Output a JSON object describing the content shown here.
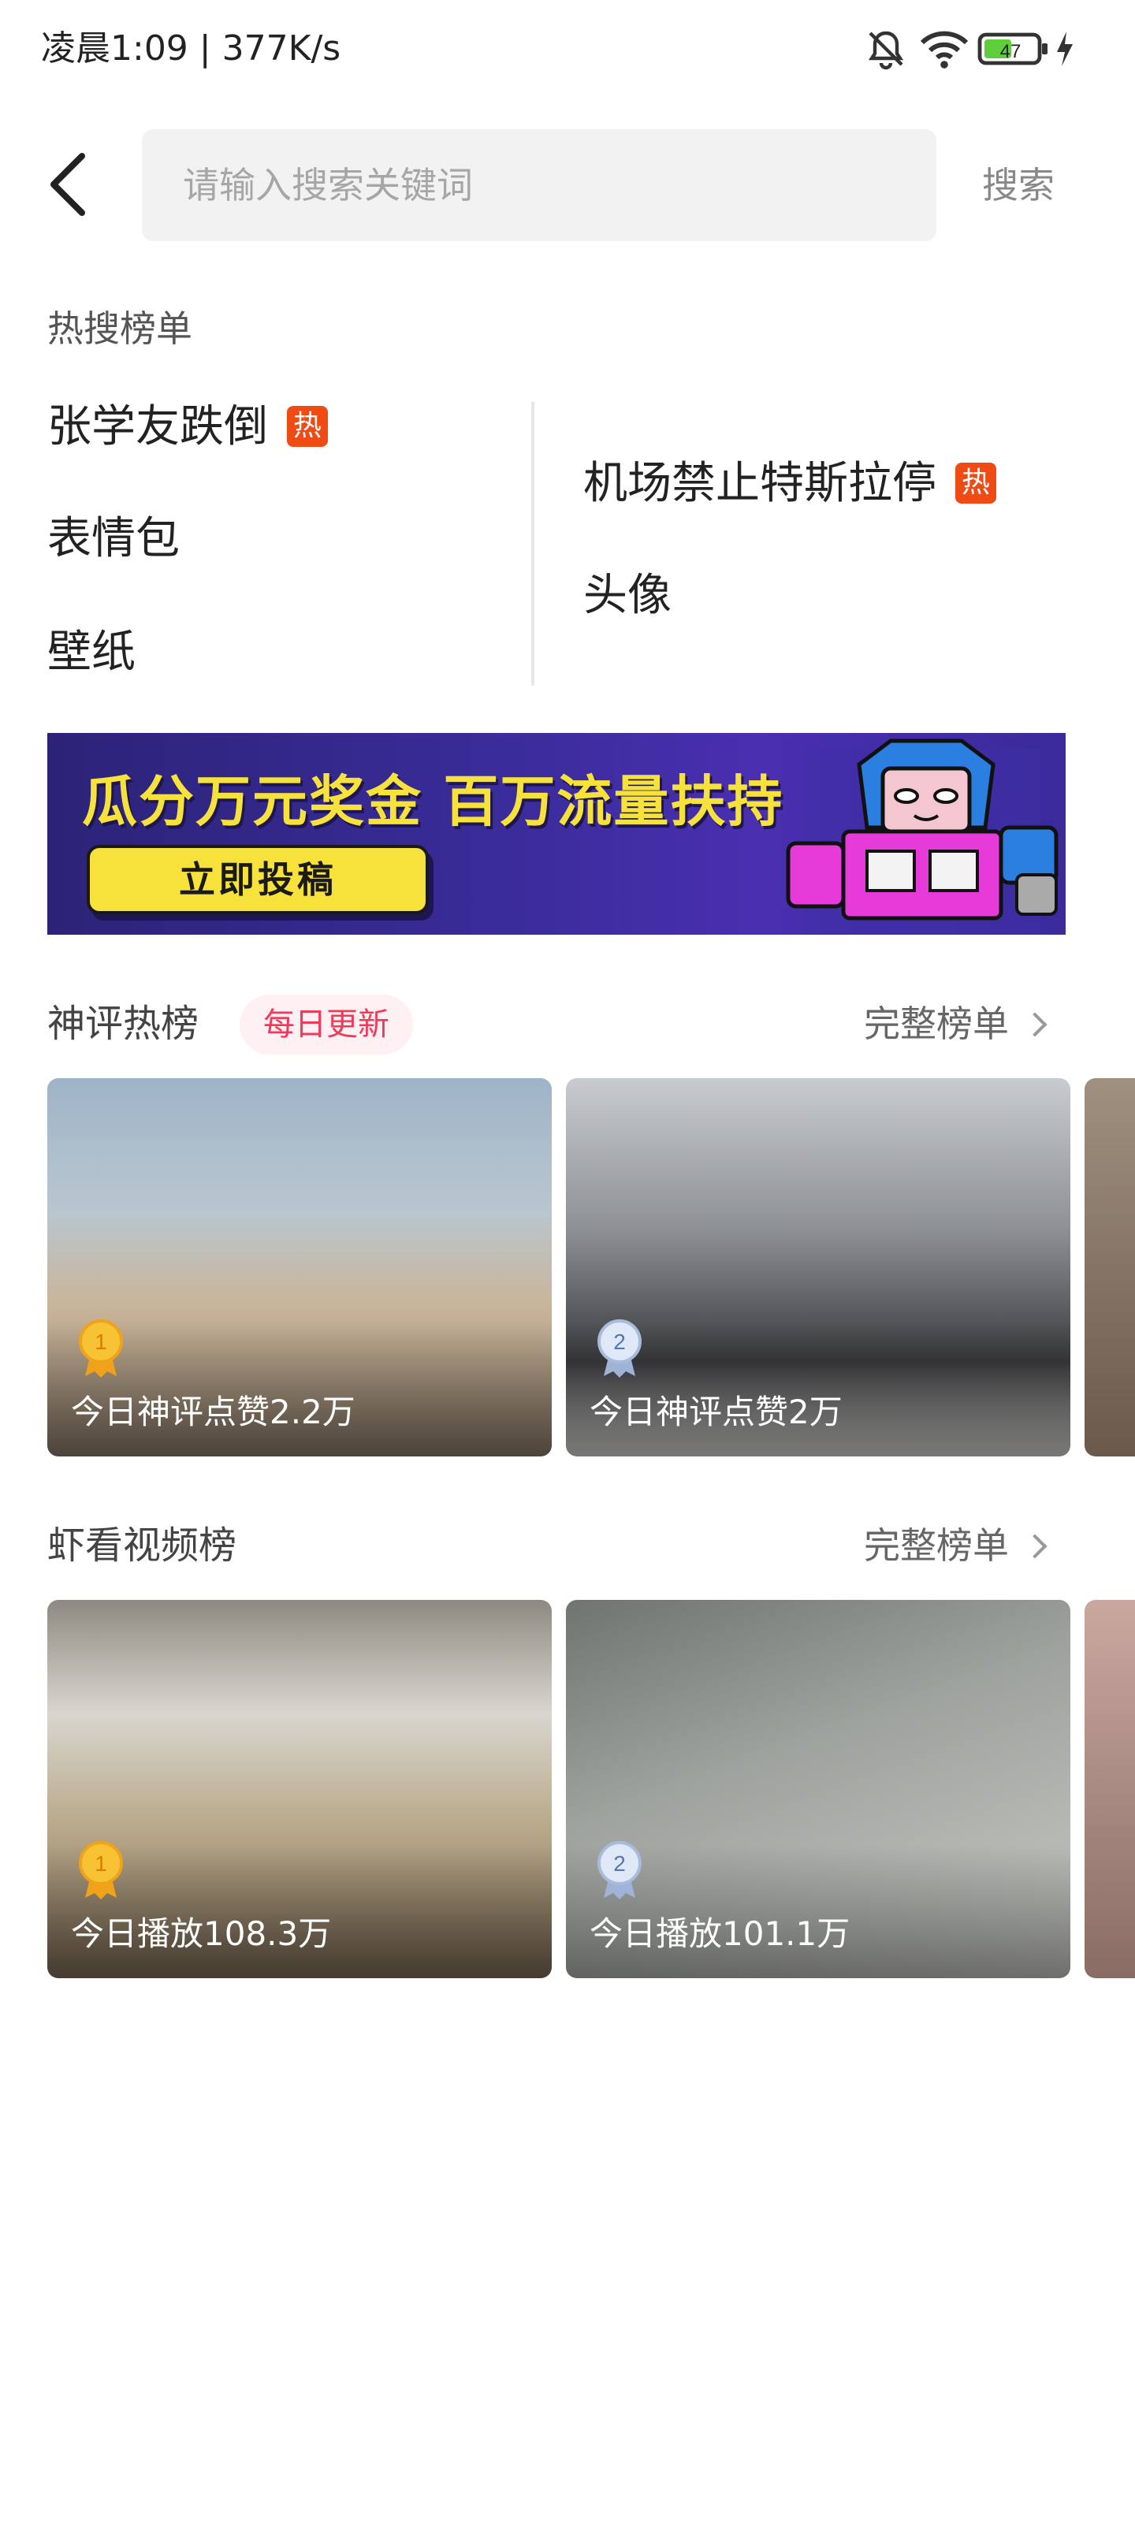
{
  "status_bar": {
    "time": "凌晨1:09 | 377K/s",
    "battery": "47"
  },
  "search": {
    "placeholder": "请输入搜索关键词",
    "button_label": "搜索"
  },
  "hot_search": {
    "title": "热搜榜单",
    "hot_badge": "热",
    "left": [
      {
        "label": "张学友跌倒",
        "hot": true
      },
      {
        "label": "表情包",
        "hot": false
      },
      {
        "label": "壁纸",
        "hot": false
      }
    ],
    "right": [
      {
        "label": "机场禁止特斯拉停",
        "hot": true
      },
      {
        "label": "头像",
        "hot": false
      }
    ]
  },
  "banner": {
    "headline": "瓜分万元奖金 百万流量扶持",
    "cta": "立即投稿"
  },
  "comment_chart": {
    "title": "神评热榜",
    "badge": "每日更新",
    "more": "完整榜单",
    "cards": [
      {
        "rank": "1",
        "label": "今日神评点赞2.2万"
      },
      {
        "rank": "2",
        "label": "今日神评点赞2万"
      }
    ]
  },
  "video_chart": {
    "title": "虾看视频榜",
    "more": "完整榜单",
    "cards": [
      {
        "rank": "1",
        "label": "今日播放108.3万"
      },
      {
        "rank": "2",
        "label": "今日播放101.1万"
      }
    ]
  },
  "colors": {
    "hot_badge": "#f04b14",
    "accent_pink": "#ee3b5a",
    "banner_yellow": "#f6e23a"
  }
}
